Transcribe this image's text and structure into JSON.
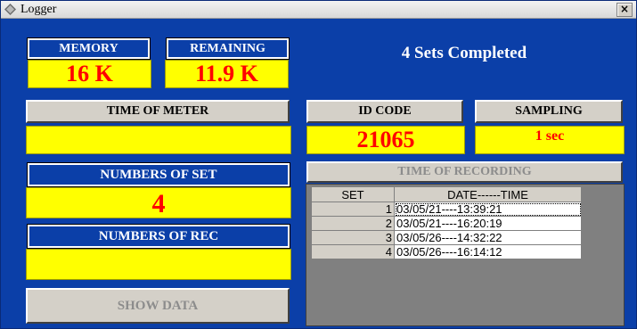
{
  "window": {
    "title": "Logger",
    "close_label": "×"
  },
  "memory": {
    "label": "MEMORY",
    "value": "16 K"
  },
  "remaining": {
    "label": "REMAINING",
    "value": "11.9 K"
  },
  "status_text": "4 Sets Completed",
  "time_of_meter": {
    "label": "TIME OF METER",
    "value": ""
  },
  "id_code": {
    "label": "ID CODE",
    "value": "21065"
  },
  "sampling": {
    "label": "SAMPLING",
    "value": "1 sec"
  },
  "numbers_of_set": {
    "label": "NUMBERS OF SET",
    "value": "4"
  },
  "numbers_of_rec": {
    "label": "NUMBERS OF REC",
    "value": ""
  },
  "time_of_recording": {
    "label": "TIME OF RECORDING"
  },
  "show_data_label": "SHOW DATA",
  "records": {
    "headers": [
      "SET",
      "DATE------TIME"
    ],
    "rows": [
      {
        "set": "1",
        "datetime": "03/05/21----13:39:21"
      },
      {
        "set": "2",
        "datetime": "03/05/21----16:20:19"
      },
      {
        "set": "3",
        "datetime": "03/05/26----14:32:22"
      },
      {
        "set": "4",
        "datetime": "03/05/26----16:14:12"
      }
    ]
  }
}
